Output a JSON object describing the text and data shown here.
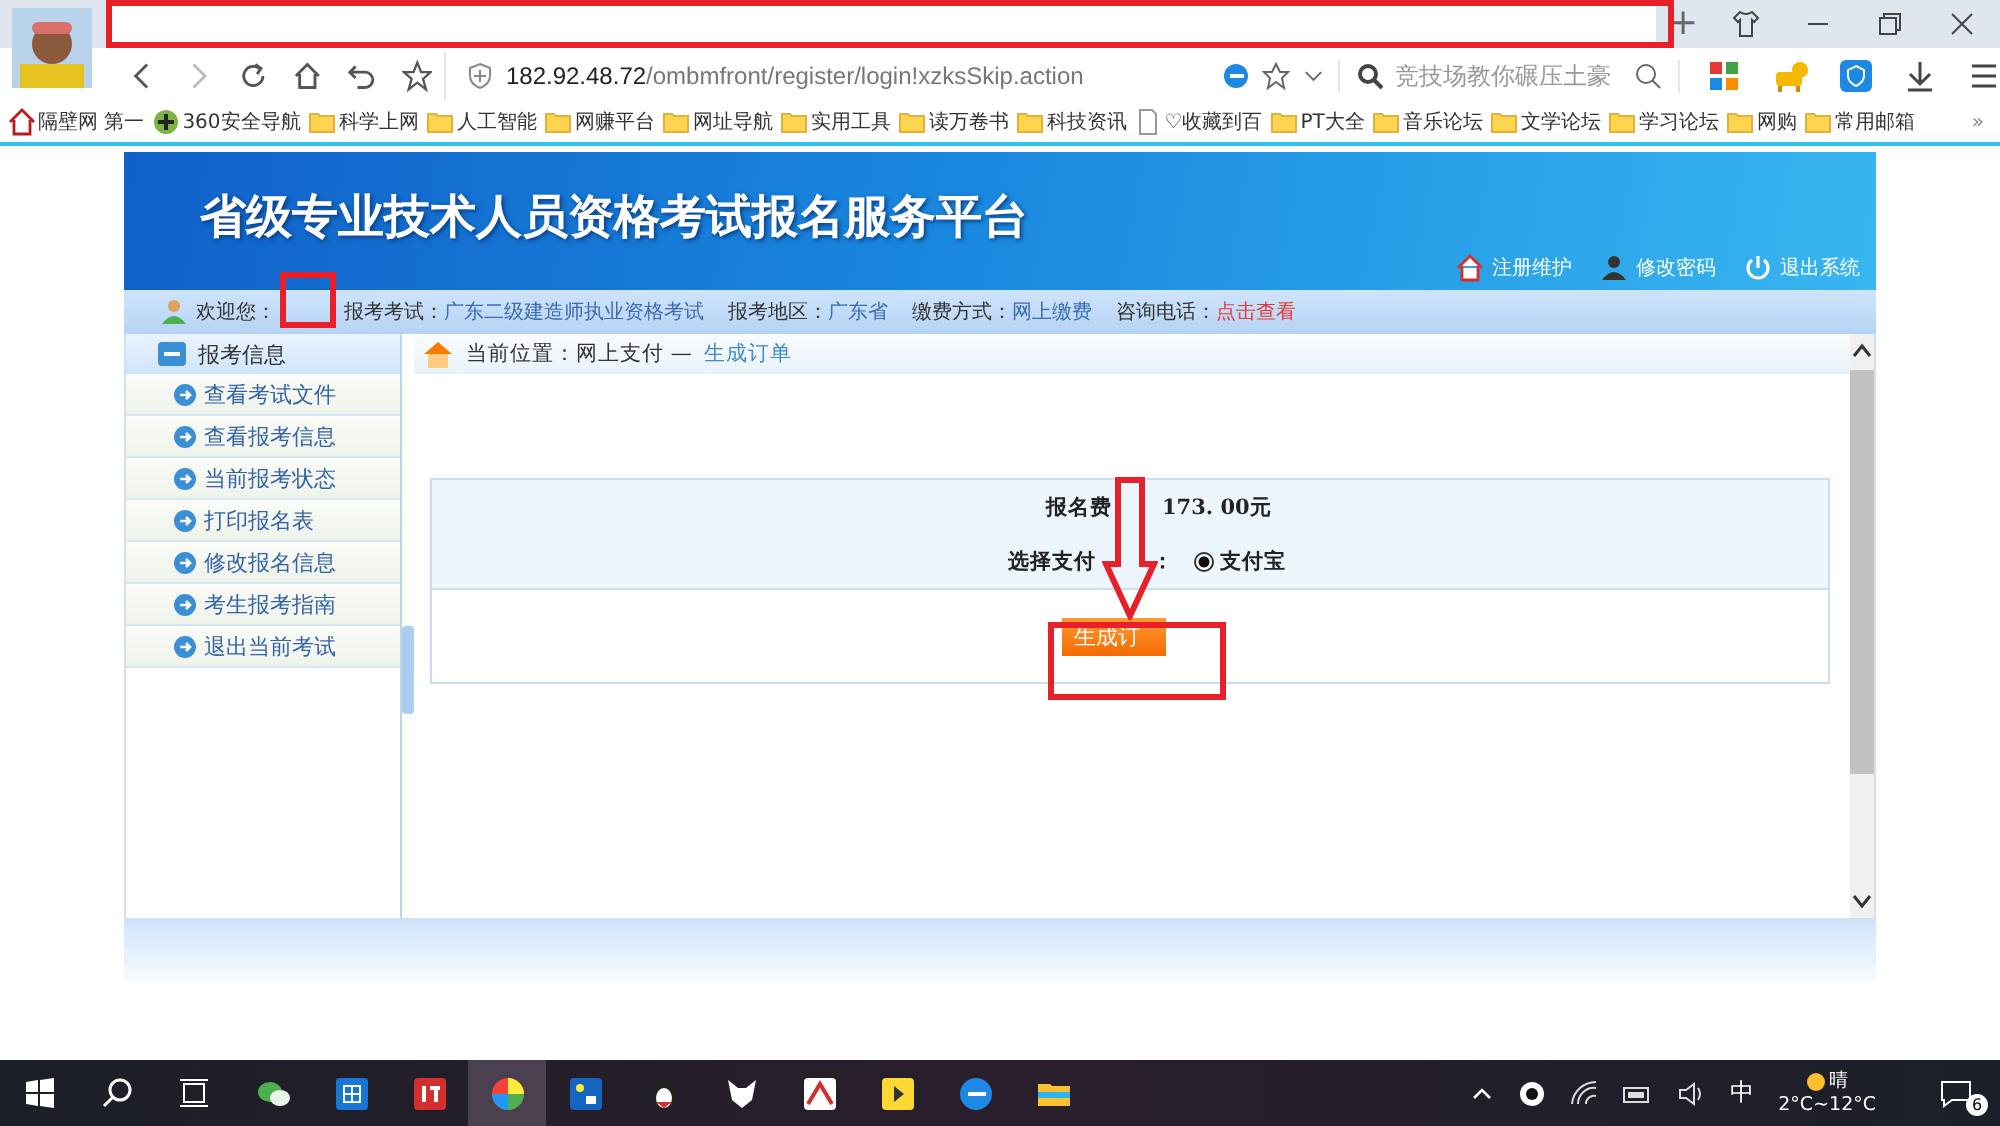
{
  "browser": {
    "address": {
      "host": "182.92.48.72",
      "path": "/ombmfront/register/login!xzksSkip.action"
    },
    "search_placeholder": "竞技场教你碾压土豪",
    "bookmarks": [
      {
        "label": "隔壁网 第一",
        "kind": "site"
      },
      {
        "label": "360安全导航",
        "kind": "nav"
      },
      {
        "label": "科学上网",
        "kind": "folder"
      },
      {
        "label": "人工智能",
        "kind": "folder"
      },
      {
        "label": "网赚平台",
        "kind": "folder"
      },
      {
        "label": "网址导航",
        "kind": "folder"
      },
      {
        "label": "实用工具",
        "kind": "folder"
      },
      {
        "label": "读万卷书",
        "kind": "folder"
      },
      {
        "label": "科技资讯",
        "kind": "folder"
      },
      {
        "label": "♡收藏到百",
        "kind": "page"
      },
      {
        "label": "PT大全",
        "kind": "folder"
      },
      {
        "label": "音乐论坛",
        "kind": "folder"
      },
      {
        "label": "文学论坛",
        "kind": "folder"
      },
      {
        "label": "学习论坛",
        "kind": "folder"
      },
      {
        "label": "网购",
        "kind": "folder"
      },
      {
        "label": "常用邮箱",
        "kind": "folder"
      }
    ],
    "overflow": "»",
    "new_tab": "+"
  },
  "header": {
    "title": "省级专业技术人员资格考试报名服务平台",
    "links": [
      {
        "label": "注册维护",
        "kind": "home"
      },
      {
        "label": "修改密码",
        "kind": "user"
      },
      {
        "label": "退出系统",
        "kind": "power"
      }
    ]
  },
  "info_bar": {
    "welcome": "欢迎您：",
    "fields": [
      {
        "label": "报考考试：",
        "value": "广东二级建造师执业资格考试",
        "kind": "plain"
      },
      {
        "label": "报考地区：",
        "value": "广东省",
        "kind": "plain"
      },
      {
        "label": "缴费方式：",
        "value": "网上缴费",
        "kind": "plain"
      },
      {
        "label": "咨询电话：",
        "value": "点击查看",
        "kind": "alert"
      }
    ]
  },
  "sidebar": {
    "title": "报考信息",
    "items": [
      "查看考试文件",
      "查看报考信息",
      "当前报考状态",
      "打印报名表",
      "修改报名信息",
      "考生报考指南",
      "退出当前考试"
    ]
  },
  "breadcrumb": {
    "label": "当前位置：",
    "section": "网上支付",
    "separator": "—",
    "current": "生成订单"
  },
  "payment": {
    "fee_label": "报名费",
    "fee_amount": "173. 00元",
    "gateway_label": "选择支付",
    "gateway_colon": "：",
    "options": [
      {
        "label": "支付宝",
        "selected": true
      }
    ],
    "submit": "生成订"
  },
  "taskbar": {
    "ime": "中",
    "weather": "晴",
    "temperature": "2°C~12°C",
    "notifications": "6"
  }
}
